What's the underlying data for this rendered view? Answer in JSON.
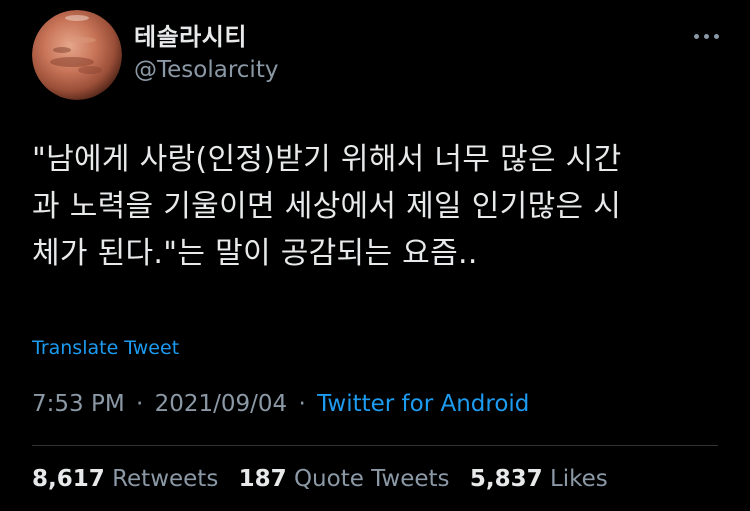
{
  "user": {
    "display_name": "테솔라시티",
    "handle": "@Tesolarcity",
    "avatar": "mars-planet-avatar"
  },
  "tweet": {
    "lines": [
      "\"남에게 사랑(인정)받기 위해서 너무 많은 시간",
      "과 노력을 기울이면 세상에서 제일 인기많은 시",
      "체가 된다.\"는 말이 공감되는 요즘.."
    ],
    "translate_label": "Translate Tweet",
    "time": "7:53 PM",
    "date": "2021/09/04",
    "separator": "·",
    "source": "Twitter for Android"
  },
  "stats": {
    "retweets": {
      "count": "8,617",
      "label": "Retweets"
    },
    "quote_tweets": {
      "count": "187",
      "label": "Quote Tweets"
    },
    "likes": {
      "count": "5,837",
      "label": "Likes"
    }
  },
  "colors": {
    "background": "#000000",
    "text": "#e7e9ea",
    "secondary": "#8b98a5",
    "accent": "#1d9bf0",
    "divider": "#2f3336"
  },
  "icons": {
    "more": "more-horizontal-icon"
  }
}
